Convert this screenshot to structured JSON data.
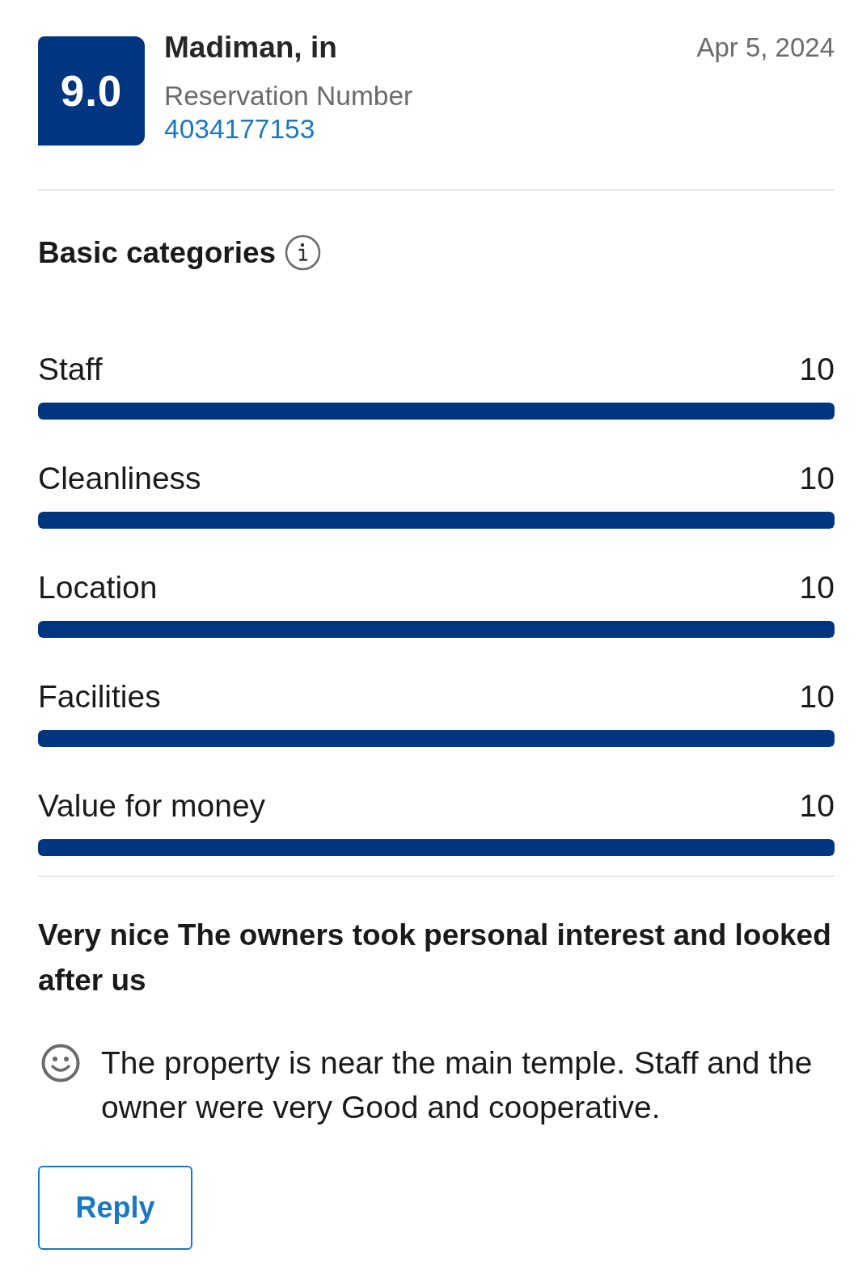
{
  "review": {
    "score": "9.0",
    "guest_name": "Madiman, in",
    "reservation_label": "Reservation Number",
    "reservation_number": "4034177153",
    "date": "Apr 5, 2024"
  },
  "categories": {
    "title": "Basic categories",
    "items": [
      {
        "name": "Staff",
        "score": "10",
        "level": 1
      },
      {
        "name": "Cleanliness",
        "score": "10",
        "level": 1
      },
      {
        "name": "Location",
        "score": "10",
        "level": 1
      },
      {
        "name": "Facilities",
        "score": "10",
        "level": 1
      },
      {
        "name": "Value for money",
        "score": "10",
        "level": 1
      }
    ]
  },
  "comment": {
    "title": "Very nice The owners took personal interest and looked after us",
    "notes": [
      {
        "kind": "positive",
        "text": "The property is near the main temple. Staff and the owner were very Good and cooperative."
      }
    ]
  },
  "buttons": [
    "Reply"
  ]
}
